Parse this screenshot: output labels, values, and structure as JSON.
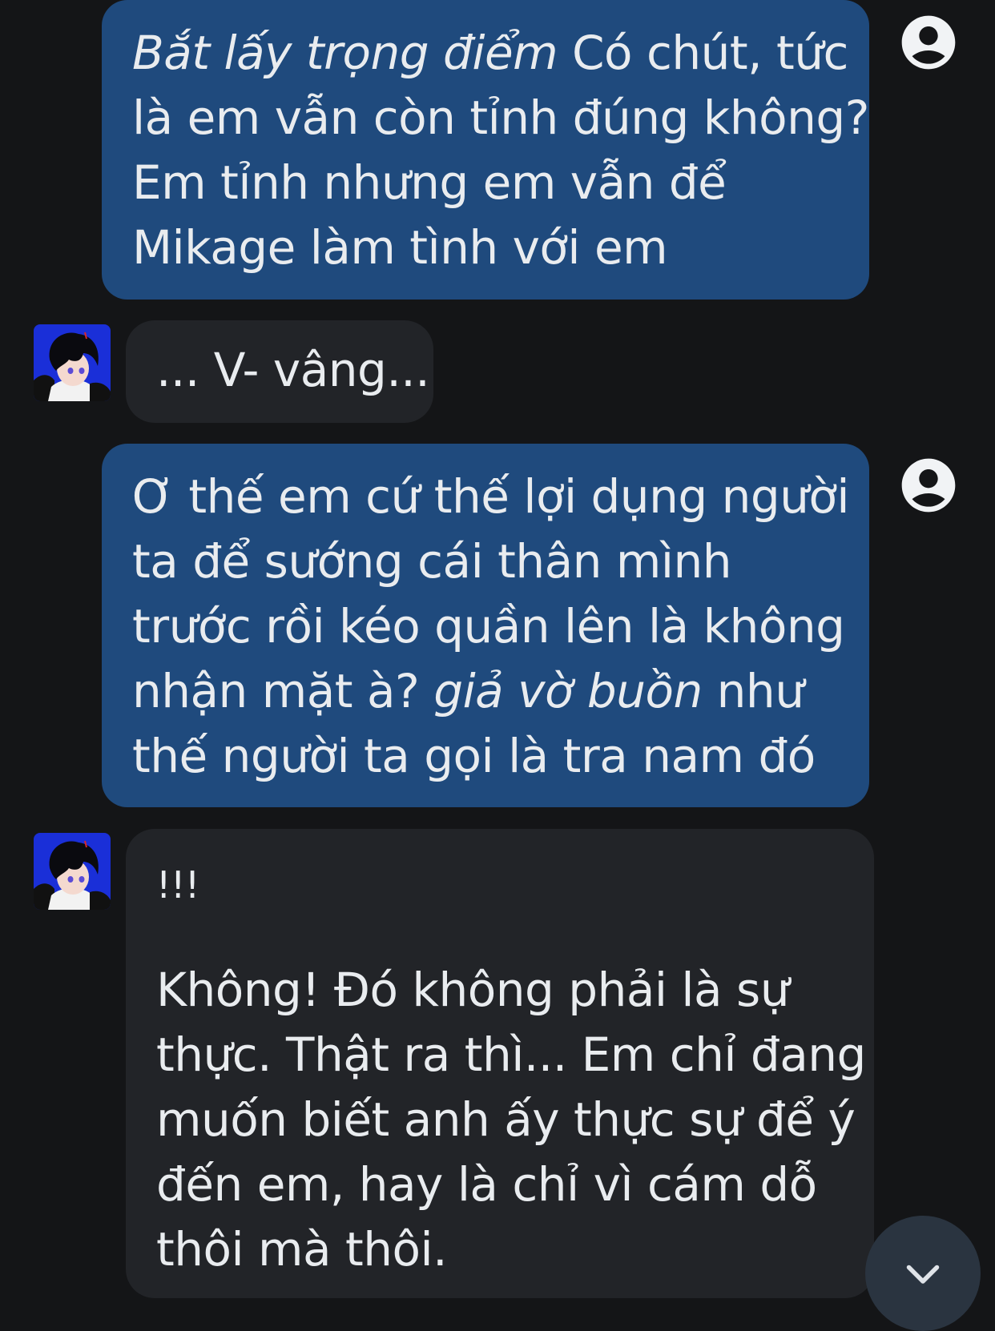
{
  "messages": [
    {
      "role": "user",
      "lines": [
        {
          "italic": "Bắt lấy trọng điểm",
          "text": " Có chút, tức"
        },
        {
          "text": "là em vẫn còn tỉnh đúng không?"
        },
        {
          "text": "Em tỉnh nhưng em vẫn để"
        },
        {
          "text": "Mikage làm tình với em"
        }
      ]
    },
    {
      "role": "bot",
      "lines": [
        {
          "text": "... V- vâng..."
        }
      ]
    },
    {
      "role": "user",
      "lines": [
        {
          "text": "Ơ thế em cứ thế lợi dụng người"
        },
        {
          "text": "ta để sướng cái thân mình"
        },
        {
          "text": "trước rồi kéo quần lên là không"
        },
        {
          "text": "nhận mặt à? ",
          "italic": "giả vờ buồn",
          "after": " như"
        },
        {
          "text": "thế người ta gọi là tra nam đó"
        }
      ]
    },
    {
      "role": "bot",
      "lines": [
        {
          "text": "!!!"
        },
        {
          "text": "Không! Đó không phải là sự"
        },
        {
          "text": "thực. Thật ra thì... Em chỉ đang"
        },
        {
          "text": "muốn biết anh ấy thực sự để ý"
        },
        {
          "text": "đến em, hay là chỉ vì cám dỗ"
        },
        {
          "text": "thôi mà thôi."
        }
      ]
    }
  ],
  "icons": {
    "user_avatar": "account-circle-icon",
    "bot_avatar": "character-avatar",
    "scroll_down": "chevron-down-icon"
  },
  "colors": {
    "background": "#141517",
    "user_bubble": "#1f4a7d",
    "bot_bubble": "#222428",
    "text": "#e9ecef",
    "avatar_blue": "#1a2fd8"
  }
}
